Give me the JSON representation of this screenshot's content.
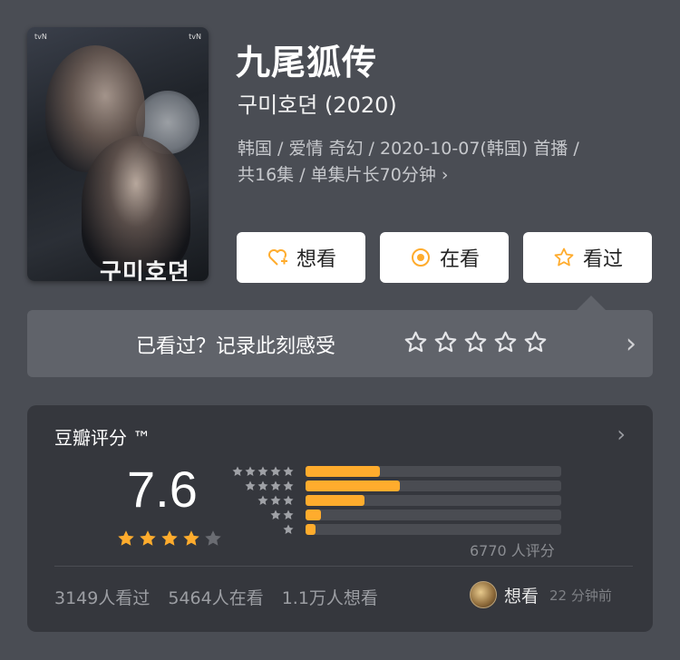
{
  "poster": {
    "title_text": "구미호뎐",
    "brand_left": "tvN",
    "brand_right": "tvN"
  },
  "movie": {
    "title": "九尾狐传",
    "original_title": "구미호뎐 (2020)",
    "meta_line1": "韩国 / 爱情 奇幻 / 2020-10-07(韩国) 首播 /",
    "meta_line2": "共16集 / 单集片长70分钟",
    "meta_chevron": "›"
  },
  "actions": {
    "want_label": "想看",
    "watching_label": "在看",
    "watched_label": "看过"
  },
  "record": {
    "prompt": "已看过？记录此刻感受",
    "star_count": 5,
    "chevron": "›"
  },
  "rating": {
    "header": "豆瓣评分 ™",
    "header_chevron": "›",
    "score": "7.6",
    "stars_filled": 4,
    "stars_total": 5,
    "distribution": [
      {
        "stars": 5,
        "fraction": 0.29
      },
      {
        "stars": 4,
        "fraction": 0.37
      },
      {
        "stars": 3,
        "fraction": 0.23
      },
      {
        "stars": 2,
        "fraction": 0.06
      },
      {
        "stars": 1,
        "fraction": 0.04
      }
    ],
    "count_text": "6770 人评分"
  },
  "stats": {
    "watched": "3149人看过",
    "watching": "5464人在看",
    "want": "1.1万人想看"
  },
  "recent_want": {
    "label": "想看",
    "time": "22 分钟前"
  },
  "colors": {
    "accent": "#ffac2d",
    "background": "#4a4d54",
    "card": "#35373d"
  }
}
